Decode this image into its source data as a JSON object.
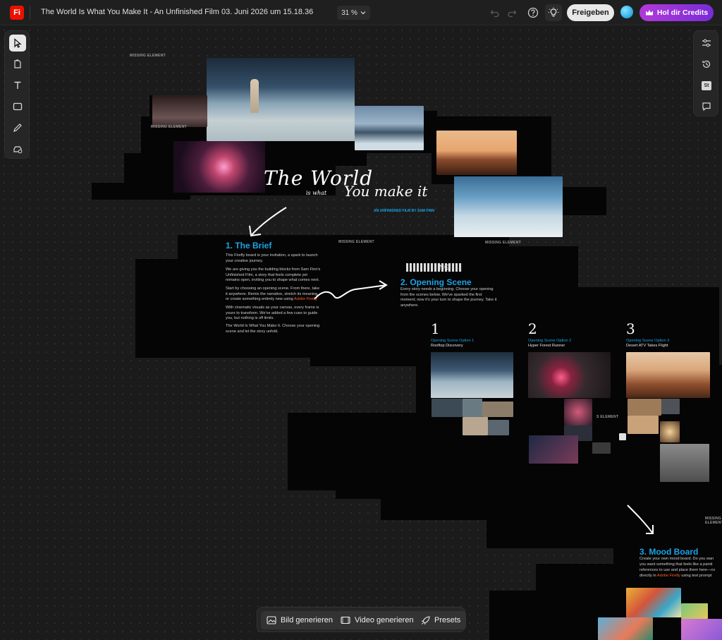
{
  "topbar": {
    "app_logo": "Fi",
    "title": "The World Is What You Make It - An Unfinished Film 03. Juni 2026 um 15.18.36",
    "zoom": "31 %",
    "share_label": "Freigeben",
    "credits_label": "Hol dir Credits"
  },
  "canvas": {
    "missing": "MISSING ELEMENT",
    "missing_partial": "S ELEMENT",
    "hero": {
      "line1": "The World",
      "line2": "is what",
      "line3": "You make it",
      "subtitle": "AN UNFINISHED FILM BY SAM FINN"
    },
    "brief": {
      "heading": "1.  The Brief",
      "p1": "This Firefly board is your invitation, a spark to launch your creative journey.",
      "p2": "We are giving you the building blocks from Sam Finn's Unfinished Film, a story that feels complete yet remains open, inviting you to shape what comes next.",
      "p3a": "Start by choosing an opening scene. From there, take it anywhere. Remix the narrative, stretch its meaning, or create something entirely new using ",
      "p3_link": "Adobe Firefly",
      "p4": "With cinematic visuals as your canvas, every frame is yours to transform. We've added a few cues to guide you, but nothing is off limits.",
      "p5": "The World Is What You Make It. Choose your opening scene and let the story unfold."
    },
    "opening": {
      "heading": "2. Opening Scene",
      "body": "Every story needs a beginning. Choose your opening from the scenes below. We've sparked the first moment; now it's your turn to shape the journey. Take it anywhere.",
      "glitch": "ING",
      "options": [
        {
          "num": "1",
          "label": "Opening Scene Option 1",
          "name": "Rooftop Discovery"
        },
        {
          "num": "2",
          "label": "Opening Scene Option 2",
          "name": "Hyper Forest Runner"
        },
        {
          "num": "3",
          "label": "Opening Scene Option 3",
          "name": "Desert ATV Takes Flight"
        }
      ]
    },
    "mood": {
      "heading": "3. Mood Board",
      "l1": "Create your own mood board. Do you wan",
      "l2": "you want something that feels like a painti",
      "l3": "references to use and place them here—co",
      "l4a": "directly in ",
      "l4_link": "Adobe Firefly",
      "l4b": " using text prompt"
    }
  },
  "bottombar": {
    "image_label": "Bild generieren",
    "video_label": "Video generieren",
    "presets_label": "Presets"
  },
  "colors": {
    "accent_blue": "#1aa4e8",
    "credits_purple": "#9b34d8",
    "firefly_red": "#eb1000",
    "link_orange": "#ff5a1f"
  }
}
